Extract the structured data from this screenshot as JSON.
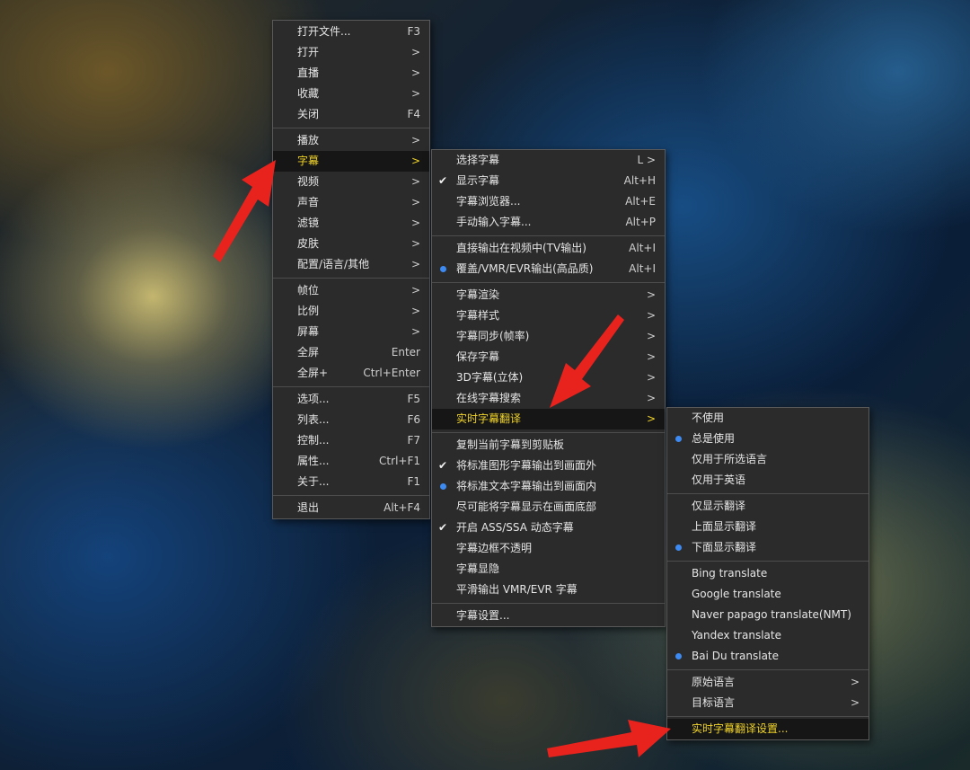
{
  "colors": {
    "menu_bg": "#2b2b2b",
    "highlight_text": "#f0d328",
    "radio_dot": "#3d8bf2",
    "arrow": "#e8231e"
  },
  "main_menu": [
    {
      "label": "打开文件...",
      "shortcut": "F3"
    },
    {
      "label": "打开",
      "shortcut": ">"
    },
    {
      "label": "直播",
      "shortcut": ">"
    },
    {
      "label": "收藏",
      "shortcut": ">"
    },
    {
      "label": "关闭",
      "shortcut": "F4"
    },
    {
      "label": "播放",
      "shortcut": ">"
    },
    {
      "label": "字幕",
      "shortcut": ">"
    },
    {
      "label": "视频",
      "shortcut": ">"
    },
    {
      "label": "声音",
      "shortcut": ">"
    },
    {
      "label": "滤镜",
      "shortcut": ">"
    },
    {
      "label": "皮肤",
      "shortcut": ">"
    },
    {
      "label": "配置/语言/其他",
      "shortcut": ">"
    },
    {
      "label": "帧位",
      "shortcut": ">"
    },
    {
      "label": "比例",
      "shortcut": ">"
    },
    {
      "label": "屏幕",
      "shortcut": ">"
    },
    {
      "label": "全屏",
      "shortcut": "Enter"
    },
    {
      "label": "全屏+",
      "shortcut": "Ctrl+Enter"
    },
    {
      "label": "选项...",
      "shortcut": "F5"
    },
    {
      "label": "列表...",
      "shortcut": "F6"
    },
    {
      "label": "控制...",
      "shortcut": "F7"
    },
    {
      "label": "属性...",
      "shortcut": "Ctrl+F1"
    },
    {
      "label": "关于...",
      "shortcut": "F1"
    },
    {
      "label": "退出",
      "shortcut": "Alt+F4"
    }
  ],
  "subtitle_menu": [
    {
      "label": "选择字幕",
      "shortcut": "L >"
    },
    {
      "label": "显示字幕",
      "shortcut": "Alt+H"
    },
    {
      "label": "字幕浏览器...",
      "shortcut": "Alt+E"
    },
    {
      "label": "手动输入字幕...",
      "shortcut": "Alt+P"
    },
    {
      "label": "直接输出在视频中(TV输出)",
      "shortcut": "Alt+I"
    },
    {
      "label": "覆盖/VMR/EVR输出(高品质)",
      "shortcut": "Alt+I"
    },
    {
      "label": "字幕渲染",
      "shortcut": ">"
    },
    {
      "label": "字幕样式",
      "shortcut": ">"
    },
    {
      "label": "字幕同步(帧率)",
      "shortcut": ">"
    },
    {
      "label": "保存字幕",
      "shortcut": ">"
    },
    {
      "label": "3D字幕(立体)",
      "shortcut": ">"
    },
    {
      "label": "在线字幕搜索",
      "shortcut": ">"
    },
    {
      "label": "实时字幕翻译",
      "shortcut": ">"
    },
    {
      "label": "复制当前字幕到剪贴板",
      "shortcut": ""
    },
    {
      "label": "将标准图形字幕输出到画面外",
      "shortcut": ""
    },
    {
      "label": "将标准文本字幕输出到画面内",
      "shortcut": ""
    },
    {
      "label": "尽可能将字幕显示在画面底部",
      "shortcut": ""
    },
    {
      "label": "开启 ASS/SSA 动态字幕",
      "shortcut": ""
    },
    {
      "label": "字幕边框不透明",
      "shortcut": ""
    },
    {
      "label": "字幕显隐",
      "shortcut": ""
    },
    {
      "label": "平滑输出 VMR/EVR 字幕",
      "shortcut": ""
    },
    {
      "label": "字幕设置...",
      "shortcut": ""
    }
  ],
  "translate_menu": [
    {
      "label": "不使用",
      "shortcut": ""
    },
    {
      "label": "总是使用",
      "shortcut": ""
    },
    {
      "label": "仅用于所选语言",
      "shortcut": ""
    },
    {
      "label": "仅用于英语",
      "shortcut": ""
    },
    {
      "label": "仅显示翻译",
      "shortcut": ""
    },
    {
      "label": "上面显示翻译",
      "shortcut": ""
    },
    {
      "label": "下面显示翻译",
      "shortcut": ""
    },
    {
      "label": "Bing translate",
      "shortcut": ""
    },
    {
      "label": "Google translate",
      "shortcut": ""
    },
    {
      "label": "Naver papago translate(NMT)",
      "shortcut": ""
    },
    {
      "label": "Yandex translate",
      "shortcut": ""
    },
    {
      "label": "Bai Du translate",
      "shortcut": ""
    },
    {
      "label": "原始语言",
      "shortcut": ">"
    },
    {
      "label": "目标语言",
      "shortcut": ">"
    },
    {
      "label": "实时字幕翻译设置...",
      "shortcut": ""
    }
  ]
}
